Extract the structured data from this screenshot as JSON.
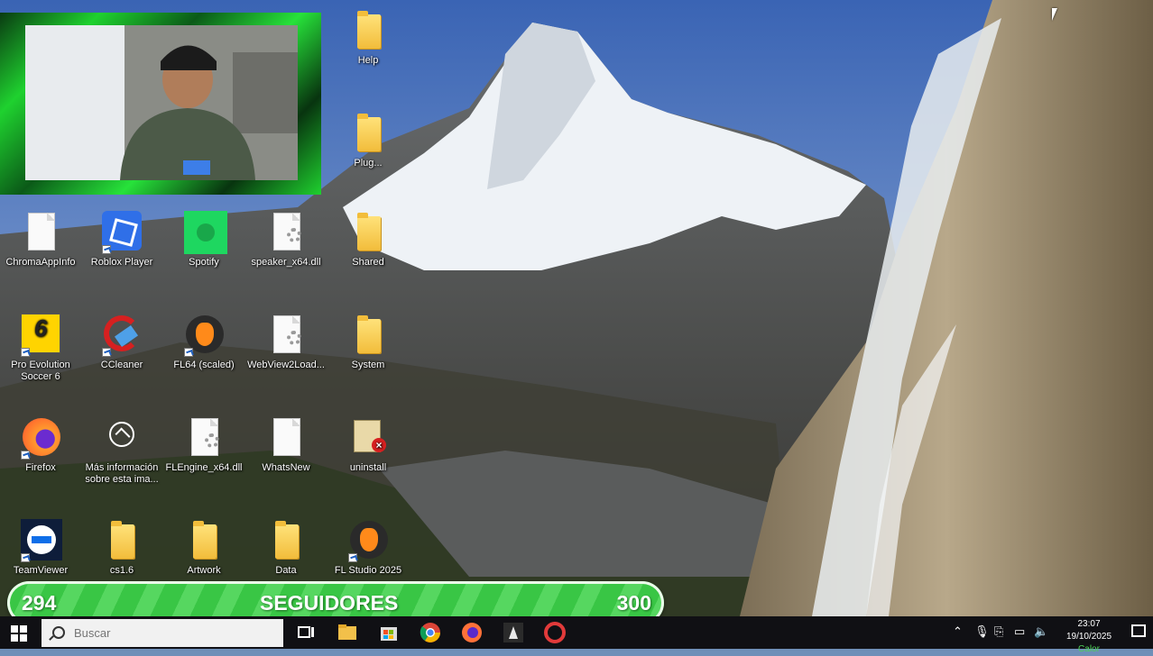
{
  "desktop": {
    "icons": [
      {
        "id": "help",
        "label": "Help",
        "type": "folder"
      },
      {
        "id": "plugins",
        "label": "Plug...",
        "type": "folder"
      },
      {
        "id": "chroma",
        "label": "ChromaAppInfo",
        "type": "doc"
      },
      {
        "id": "roblox",
        "label": "Roblox Player",
        "type": "roblox"
      },
      {
        "id": "spotify",
        "label": "Spotify",
        "type": "spotify"
      },
      {
        "id": "speaker",
        "label": "speaker_x64.dll",
        "type": "dll"
      },
      {
        "id": "shared",
        "label": "Shared",
        "type": "folder"
      },
      {
        "id": "pes",
        "label": "Pro Evolution Soccer 6",
        "type": "pes"
      },
      {
        "id": "ccleaner",
        "label": "CCleaner",
        "type": "ccleaner"
      },
      {
        "id": "fl64",
        "label": "FL64 (scaled)",
        "type": "fl"
      },
      {
        "id": "webview",
        "label": "WebView2Load...",
        "type": "dll"
      },
      {
        "id": "system",
        "label": "System",
        "type": "folder"
      },
      {
        "id": "firefox",
        "label": "Firefox",
        "type": "firefox"
      },
      {
        "id": "masinfo",
        "label": "Más información sobre esta ima...",
        "type": "info"
      },
      {
        "id": "flengine",
        "label": "FLEngine_x64.dll",
        "type": "dll"
      },
      {
        "id": "whatsnew",
        "label": "WhatsNew",
        "type": "doc"
      },
      {
        "id": "uninstall",
        "label": "uninstall",
        "type": "uninstall"
      },
      {
        "id": "teamviewer",
        "label": "TeamViewer",
        "type": "teamviewer"
      },
      {
        "id": "cs16",
        "label": "cs1.6",
        "type": "folder"
      },
      {
        "id": "artwork",
        "label": "Artwork",
        "type": "folder"
      },
      {
        "id": "data",
        "label": "Data",
        "type": "folder"
      },
      {
        "id": "flstudio",
        "label": "FL Studio 2025",
        "type": "fl"
      }
    ]
  },
  "followers_bar": {
    "current": "294",
    "label": "SEGUIDORES",
    "goal": "300",
    "progress_fraction": 0.98
  },
  "taskbar": {
    "search_placeholder": "Buscar",
    "apps": [
      "task-view-icon",
      "file-explorer-icon",
      "store-icon",
      "chrome-icon",
      "firefox-icon",
      "fl-icon",
      "opera-icon"
    ],
    "clock_time": "23:07",
    "clock_date": "19/10/2025",
    "status_note": "Calor"
  },
  "colors": {
    "followers_green": "#39c645",
    "webcam_frame_green": "#1fd12f",
    "taskbar_bg": "#101014"
  }
}
